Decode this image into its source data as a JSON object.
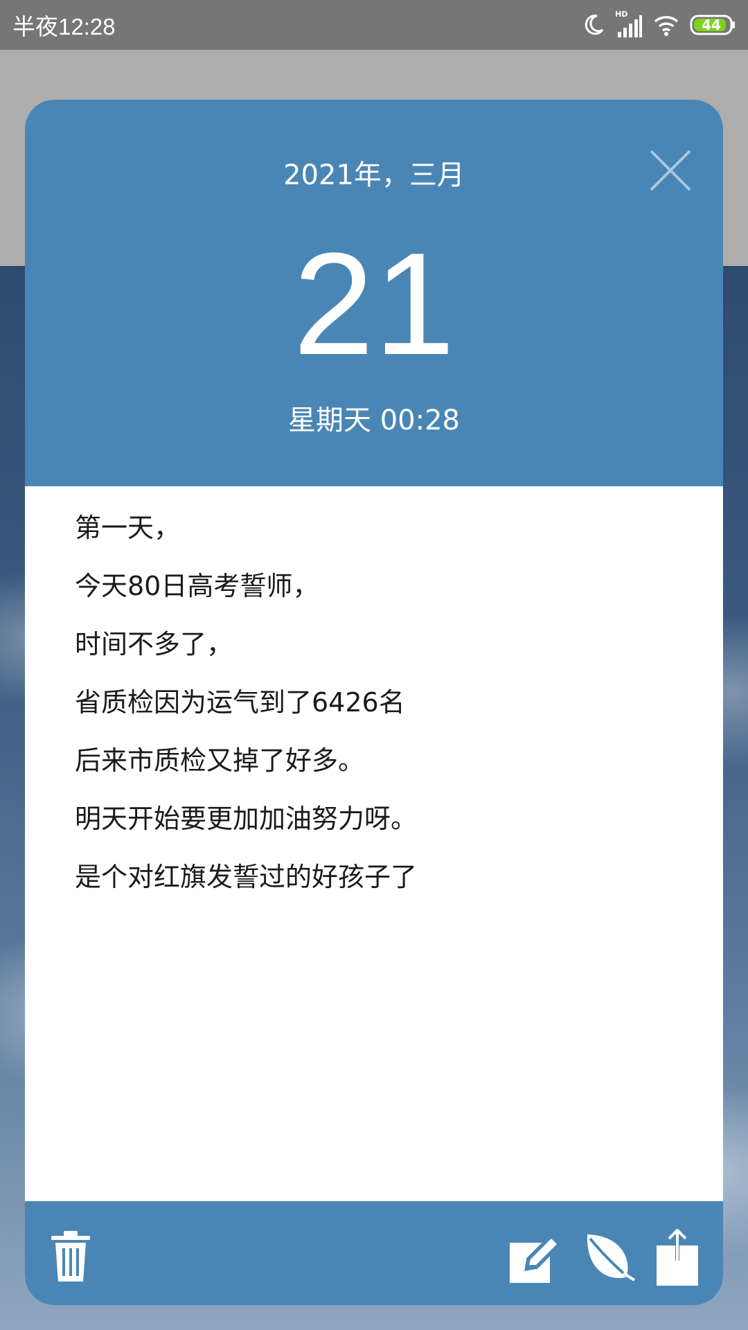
{
  "status_bar": {
    "time": "半夜12:28",
    "hd_label": "HD",
    "battery": "44",
    "battery_color": "#7ed321"
  },
  "dialog": {
    "accent_color": "#4a86b5",
    "header": {
      "year_month": "2021年，三月",
      "day": "21",
      "weekday_time": "星期天 00:28",
      "close_icon": "close-icon"
    },
    "note": {
      "lines": [
        "第一天，",
        "今天80日高考誓师，",
        "时间不多了，",
        "省质检因为运气到了6426名",
        "后来市质检又掉了好多。",
        "明天开始要更加加油努力呀。",
        "是个对红旗发誓过的好孩子了"
      ]
    },
    "footer": {
      "left_icon": "trash-icon",
      "right_icons": [
        "edit-icon",
        "leaf-icon",
        "share-icon"
      ]
    }
  }
}
